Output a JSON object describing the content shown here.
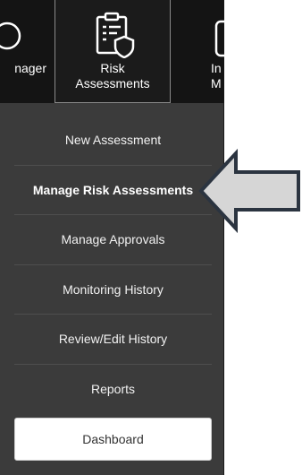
{
  "top_nav": {
    "left_partial_label": "nager",
    "active_tab_label_line1": "Risk",
    "active_tab_label_line2": "Assessments",
    "right_partial_label_line1": "In",
    "right_partial_label_line2": "M"
  },
  "side_menu": {
    "items": [
      {
        "label": "New Assessment",
        "active": false
      },
      {
        "label": "Manage Risk Assessments",
        "active": true
      },
      {
        "label": "Manage Approvals",
        "active": false
      },
      {
        "label": "Monitoring History",
        "active": false
      },
      {
        "label": "Review/Edit History",
        "active": false
      },
      {
        "label": "Reports",
        "active": false
      }
    ],
    "dashboard_label": "Dashboard"
  },
  "annotation": {
    "pointer": "arrow-left-icon",
    "fill": "#d6d6d6",
    "stroke": "#2b3440"
  },
  "colors": {
    "panel_bg": "#3b3b3b",
    "topnav_bg": "#141414",
    "text": "#ffffff"
  }
}
